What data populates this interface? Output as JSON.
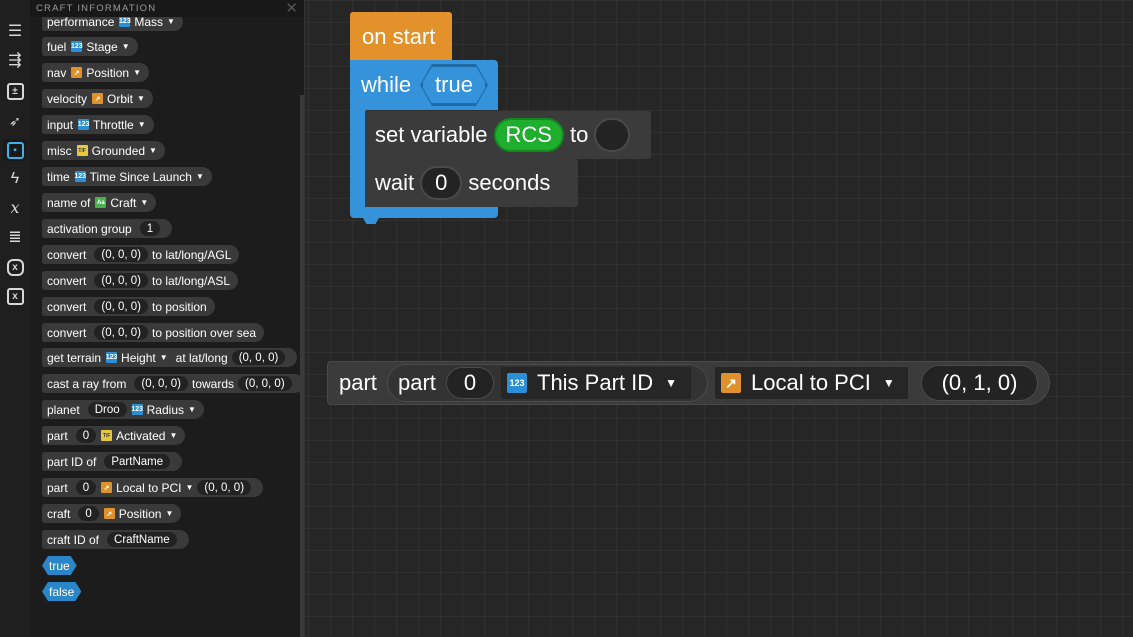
{
  "flyout": {
    "title": "CRAFT INFORMATION",
    "close_glyph": "✕",
    "blocks": {
      "performance": {
        "label": "performance",
        "type_icon": "number",
        "value": "Mass"
      },
      "fuel": {
        "label": "fuel",
        "type_icon": "number",
        "value": "Stage"
      },
      "nav": {
        "label": "nav",
        "type_icon": "vector",
        "value": "Position"
      },
      "velocity": {
        "label": "velocity",
        "type_icon": "vector",
        "value": "Orbit"
      },
      "input": {
        "label": "input",
        "type_icon": "number",
        "value": "Throttle"
      },
      "misc": {
        "label": "misc",
        "type_icon": "boolean",
        "value": "Grounded"
      },
      "time": {
        "label": "time",
        "type_icon": "number",
        "value": "Time Since Launch"
      },
      "name_of": {
        "label": "name of",
        "type_icon": "text",
        "value": "Craft"
      },
      "activation_group": {
        "label": "activation group",
        "slot": "1"
      },
      "convert_agl": {
        "label": "convert",
        "slot": "(0, 0, 0)",
        "suffix": "to lat/long/AGL"
      },
      "convert_asl": {
        "label": "convert",
        "slot": "(0, 0, 0)",
        "suffix": "to lat/long/ASL"
      },
      "convert_pos": {
        "label": "convert",
        "slot": "(0, 0, 0)",
        "suffix": "to position"
      },
      "convert_sea": {
        "label": "convert",
        "slot": "(0, 0, 0)",
        "suffix": "to position over sea"
      },
      "get_terrain": {
        "label": "get terrain",
        "type_icon": "number",
        "value": "Height",
        "mid": "at lat/long",
        "slot": "(0, 0, 0)"
      },
      "cast_ray": {
        "label": "cast a ray from",
        "slot1": "(0, 0, 0)",
        "mid": "towards",
        "slot2": "(0, 0, 0)"
      },
      "planet": {
        "label": "planet",
        "slot": "Droo",
        "type_icon": "number",
        "value": "Radius"
      },
      "part_activated": {
        "label": "part",
        "slot": "0",
        "type_icon": "boolean",
        "value": "Activated"
      },
      "part_id_of": {
        "label": "part ID of",
        "slot": "PartName"
      },
      "part_local": {
        "label": "part",
        "slot": "0",
        "type_icon": "vector",
        "value": "Local to PCI",
        "slot2": "(0, 0, 0)"
      },
      "craft_position": {
        "label": "craft",
        "slot": "0",
        "type_icon": "vector",
        "value": "Position"
      },
      "craft_id_of": {
        "label": "craft ID of",
        "slot": "CraftName"
      },
      "true_block": "true",
      "false_block": "false"
    }
  },
  "type_icons": {
    "number": "123",
    "vector": "↗",
    "boolean": "T/F",
    "text": "Aa"
  },
  "rail": {
    "items": [
      {
        "name": "menu-icon",
        "glyph": "☰"
      },
      {
        "name": "program-flow-icon",
        "glyph": "⇶"
      },
      {
        "name": "operators-icon",
        "glyph": "±"
      },
      {
        "name": "craft-control-icon",
        "glyph": "🚀"
      },
      {
        "name": "craft-information-icon",
        "glyph": "▣"
      },
      {
        "name": "events-icon",
        "glyph": "ϟ"
      },
      {
        "name": "variables-icon",
        "glyph": "𝑥"
      },
      {
        "name": "lists-icon",
        "glyph": "≣"
      },
      {
        "name": "custom-instructions-icon",
        "glyph": "x"
      },
      {
        "name": "custom-expressions-icon",
        "glyph": "x"
      }
    ]
  },
  "workspace": {
    "event": {
      "label": "on start"
    },
    "while": {
      "label": "while",
      "condition": "true"
    },
    "set_variable": {
      "label": "set variable",
      "variable": "RCS",
      "to": "to"
    },
    "wait": {
      "label": "wait",
      "value": "0",
      "suffix": "seconds"
    },
    "part_block": {
      "outer_label": "part",
      "inner_label": "part",
      "part_index": "0",
      "property": "This Part ID",
      "conversion": "Local to PCI",
      "vector": "(0, 1, 0)"
    }
  },
  "colors": {
    "background": "#262626",
    "event_orange": "#e3922b",
    "loop_blue": "#3593db",
    "variable_green": "#1fae2e",
    "selected_category": "#3fb1ea"
  }
}
